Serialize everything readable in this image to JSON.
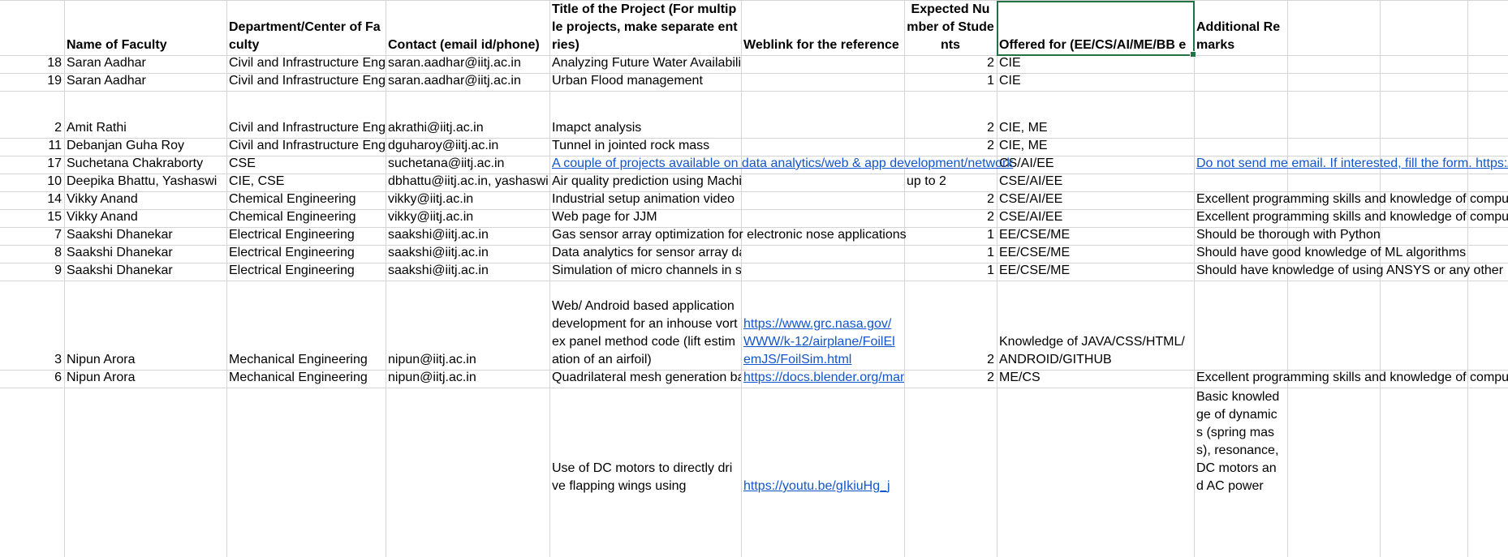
{
  "headers": [
    "",
    "Name of Faculty",
    "Department/Center of Faculty",
    "Contact (email id/phone)",
    "Title of the Project (For multiple projects, make separate entries)",
    "Weblink for the reference",
    "Expected Number of Students",
    "Offered for (EE/CS/AI/ME/BB e",
    "Additional Remarks"
  ],
  "rows": [
    {
      "sn": "18",
      "name": "Saran Aadhar",
      "dept": "Civil and Infrastructure Engineering",
      "contact": "saran.aadhar@iitj.ac.in",
      "title": "Analyzing Future Water Availability in Dehradun City",
      "weblink": "",
      "students": "2",
      "offered": "CIE",
      "remarks": ""
    },
    {
      "sn": "19",
      "name": "Saran Aadhar",
      "dept": "Civil and Infrastructure Engineering",
      "contact": "saran.aadhar@iitj.ac.in",
      "title": "Urban Flood management",
      "weblink": "",
      "students": "1",
      "offered": "CIE",
      "remarks": ""
    },
    {
      "sn": "2",
      "name": "Amit Rathi",
      "dept": "Civil and Infrastructure Engineering",
      "contact": "akrathi@iitj.ac.in",
      "title": "Imapct analysis",
      "weblink": "",
      "students": "2",
      "offered": "CIE, ME",
      "remarks": ""
    },
    {
      "sn": "11",
      "name": "Debanjan Guha Roy",
      "dept": "Civil and Infrastructure Engineering",
      "contact": "dguharoy@iitj.ac.in",
      "title": "Tunnel in jointed rock mass",
      "weblink": "",
      "students": "2",
      "offered": "CIE, ME",
      "remarks": ""
    },
    {
      "sn": "17",
      "name": "Suchetana Chakraborty",
      "dept": "CSE",
      "contact": "suchetana@iitj.ac.in",
      "title": "A couple of projects available on data analytics/web & app development/network",
      "weblink": "",
      "students": "",
      "offered": "CS/AI/EE",
      "remarks": "Do not send me email. If interested, fill the form. https://"
    },
    {
      "sn": "10",
      "name": "Deepika Bhattu, Yashaswi",
      "dept": "CIE, CSE",
      "contact": "dbhattu@iitj.ac.in, yashaswi",
      "title": "Air quality prediction using Machine Learning",
      "weblink": "",
      "students": "up to 2",
      "offered": "CSE/AI/EE",
      "remarks": ""
    },
    {
      "sn": "14",
      "name": "Vikky Anand",
      "dept": "Chemical Engineering",
      "contact": "vikky@iitj.ac.in",
      "title": "Industrial setup animation video",
      "weblink": "",
      "students": "2",
      "offered": "CSE/AI/EE",
      "remarks": "Excellent programming skills and knowledge of computer"
    },
    {
      "sn": "15",
      "name": "Vikky Anand",
      "dept": "Chemical Engineering",
      "contact": "vikky@iitj.ac.in",
      "title": "Web page for JJM",
      "weblink": "",
      "students": "2",
      "offered": "CSE/AI/EE",
      "remarks": "Excellent programming skills and knowledge of computer"
    },
    {
      "sn": "7",
      "name": "Saakshi Dhanekar",
      "dept": "Electrical Engineering",
      "contact": "saakshi@iitj.ac.in",
      "title": "Gas sensor array optimization for electronic nose applications",
      "weblink": "",
      "students": "1",
      "offered": "EE/CSE/ME",
      "remarks": "Should be thorough with Python"
    },
    {
      "sn": "8",
      "name": "Saakshi Dhanekar",
      "dept": "Electrical Engineering",
      "contact": "saakshi@iitj.ac.in",
      "title": "Data analytics for sensor array data",
      "weblink": "",
      "students": "1",
      "offered": "EE/CSE/ME",
      "remarks": "Should have good knowledge of ML algorithms"
    },
    {
      "sn": "9",
      "name": "Saakshi Dhanekar",
      "dept": "Electrical Engineering",
      "contact": "saakshi@iitj.ac.in",
      "title": "Simulation of micro channels in silicon using ANSYS or equivalent",
      "weblink": "",
      "students": "1",
      "offered": "EE/CSE/ME",
      "remarks": "Should have knowledge of using ANSYS or any other"
    },
    {
      "sn": "3",
      "name": "Nipun Arora",
      "dept": "Mechanical Engineering",
      "contact": "nipun@iitj.ac.in",
      "title": "Web/ Android based applicationdevelopment for an inhouse vortex panel method code (lift estimation of an airfoil)",
      "weblink": "https://www.grc.nasa.gov/WWW/k-12/airplane/FoilElemJS/FoilSim.html",
      "students": "2",
      "offered": "Knowledge of JAVA/CSS/HTML/ANDROID/GITHUB",
      "remarks": ""
    },
    {
      "sn": "6",
      "name": "Nipun Arora",
      "dept": "Mechanical Engineering",
      "contact": "nipun@iitj.ac.in",
      "title": "Quadrilateral mesh generation based",
      "weblink": "https://docs.blender.org/manual",
      "students": "2",
      "offered": "ME/CS",
      "remarks": "Excellent programming skills and knowledge of computer"
    },
    {
      "sn": "",
      "name": "",
      "dept": "",
      "contact": "",
      "title": "Use of DC motors to directly drive flapping wings using",
      "weblink": "https://youtu.be/gIkiuHg_j",
      "students": "",
      "offered": "",
      "remarks": "Basic knowledge of dynamics (spring mass), resonance, DC motors and AC power"
    }
  ]
}
